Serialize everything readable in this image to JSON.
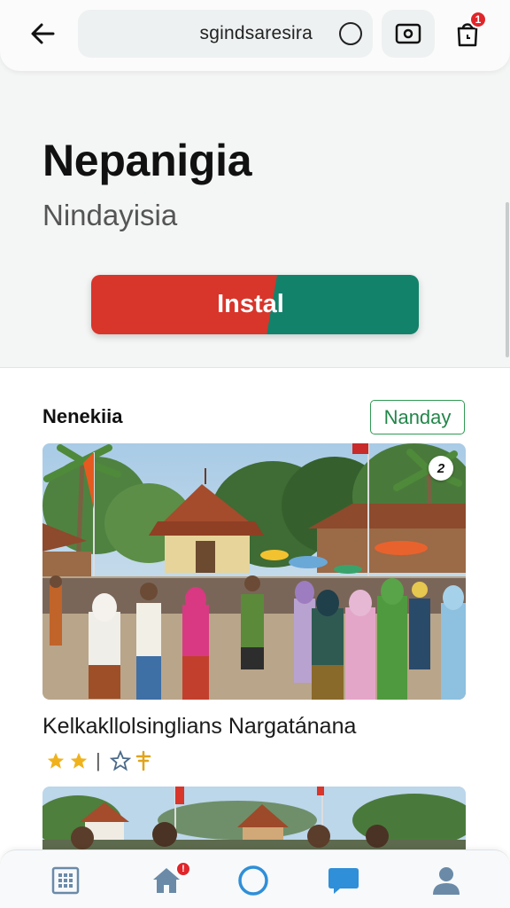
{
  "header": {
    "search_text": "sgindsaresira",
    "cart_badge": "1"
  },
  "hero": {
    "title": "Nepanigia",
    "subtitle": "Nindayisia",
    "install_label": "Instal"
  },
  "section": {
    "title": "Nenekiia",
    "tag": "Nanday"
  },
  "card": {
    "photo_count": "2",
    "title": "Kelkakllolsinglians Nargatánana",
    "rating_separator": "|"
  },
  "bottom_nav": {
    "home_badge": "!"
  },
  "colors": {
    "install_red": "#d8352b",
    "install_green": "#13826b",
    "tag_green": "#23864a",
    "badge_red": "#e0262b",
    "nav_blue": "#2f8fd8",
    "star_gold": "#f0b21c"
  }
}
